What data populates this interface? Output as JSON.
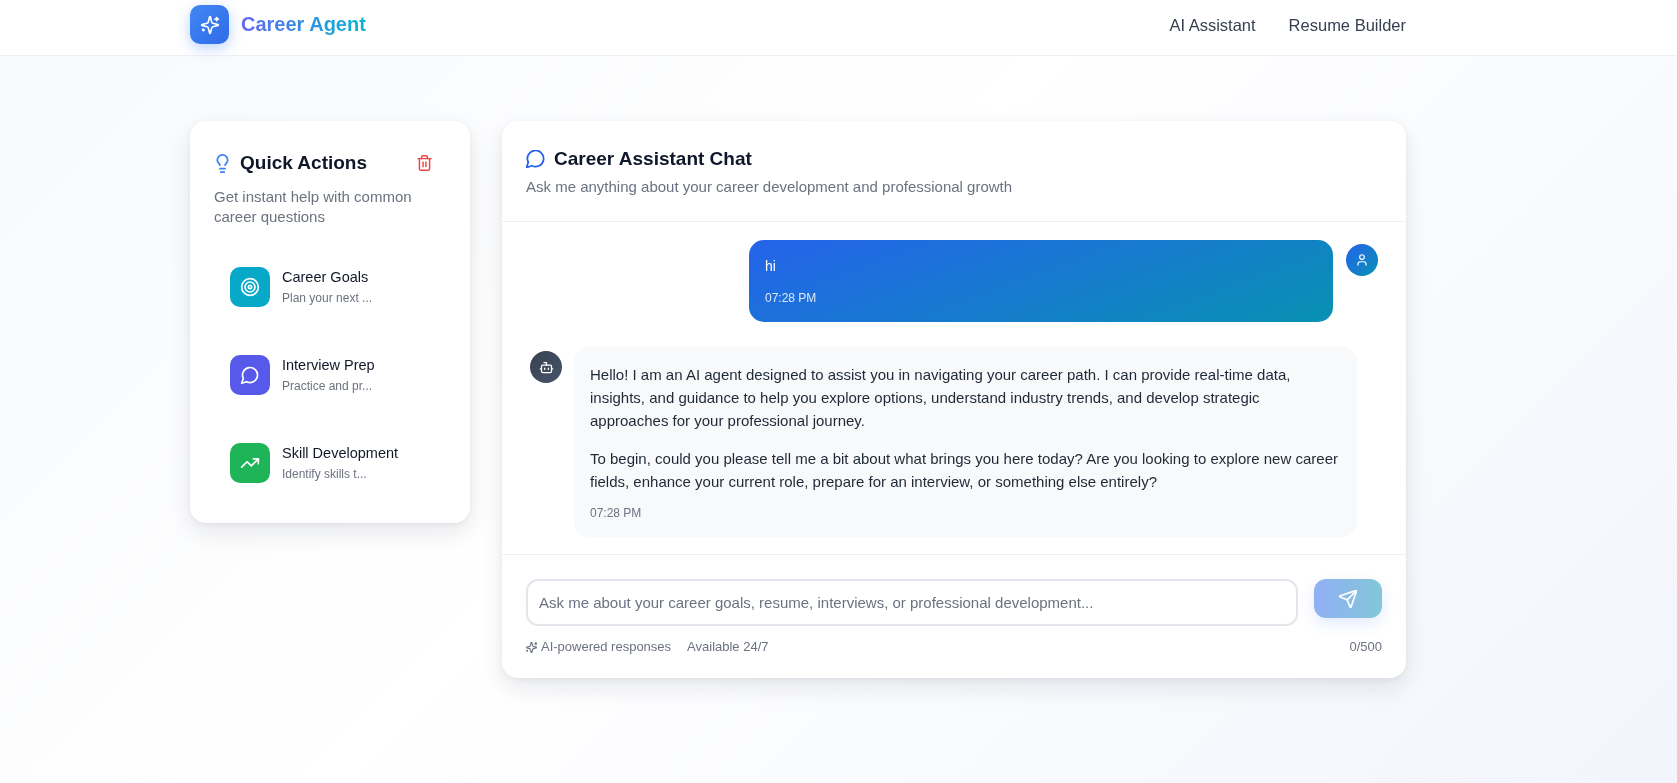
{
  "header": {
    "brand": "Career Agent",
    "nav": [
      {
        "label": "AI Assistant"
      },
      {
        "label": "Resume Builder"
      }
    ]
  },
  "quick_actions": {
    "title": "Quick Actions",
    "subtitle": "Get instant help with common career questions",
    "items": [
      {
        "title": "Career Goals",
        "description": "Plan your next ...",
        "color": "#07a8c8"
      },
      {
        "title": "Interview Prep",
        "description": "Practice and pr...",
        "color": "#5659ea"
      },
      {
        "title": "Skill Development",
        "description": "Identify skills t...",
        "color": "#1fb457"
      }
    ]
  },
  "chat": {
    "title": "Career Assistant Chat",
    "subtitle": "Ask me anything about your career development and professional growth",
    "messages": [
      {
        "kind": "user",
        "paragraphs": [
          "hi"
        ],
        "time": "07:28 PM"
      },
      {
        "kind": "bot",
        "paragraphs": [
          "Hello! I am an AI agent designed to assist you in navigating your career path. I can provide real-time data, insights, and guidance to help you explore options, understand industry trends, and develop strategic approaches for your professional journey.",
          "To begin, could you please tell me a bit about what brings you here today? Are you looking to explore new career fields, enhance your current role, prepare for an interview, or something else entirely?"
        ],
        "time": "07:28 PM"
      }
    ],
    "input": {
      "placeholder": "Ask me about your career goals, resume, interviews, or professional development..."
    },
    "send_button": {
      "disabled": true
    },
    "footer": {
      "notes": [
        "AI-powered responses",
        "Available 24/7"
      ],
      "counter": "0/500"
    }
  }
}
